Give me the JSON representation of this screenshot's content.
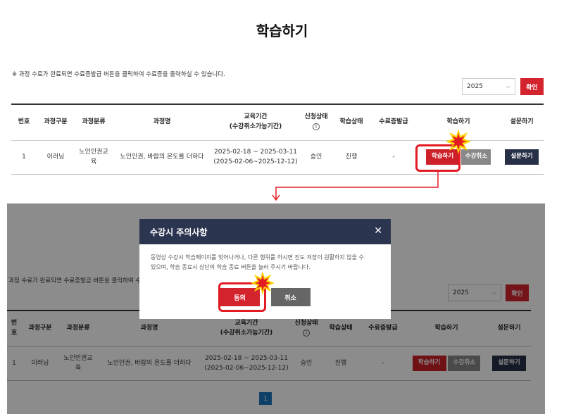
{
  "page_title": "학습하기",
  "notice": "※ 과정 수료가 완료되면 수료증발급 버튼을 클릭하여 수료증을 출력하실 수 있습니다.",
  "overlay_notice": "과정 수료가 완료되면 수료증발급 버튼을 클릭하여 수",
  "filter": {
    "year": "2025",
    "confirm_label": "확인"
  },
  "table": {
    "headers": {
      "no": "번호",
      "type": "과정구분",
      "category": "과정분류",
      "name": "과정명",
      "period_line1": "교육기간",
      "period_line2": "(수강취소가능기간)",
      "apply_status": "신청상태",
      "apply_info_icon": "i",
      "learn_status": "학습상태",
      "certificate": "수료증발급",
      "study": "학습하기",
      "survey": "설문하기"
    },
    "row": {
      "no": "1",
      "type": "이러닝",
      "category_main": "노인인권교",
      "category_sub": "육",
      "name": "노인인권, 바람의 온도를 더하다",
      "period_line1": "2025-02-18 ~ 2025-03-11",
      "period_line2": "(2025-02-06~2025-12-12)",
      "apply_status": "승인",
      "learn_status": "진행",
      "certificate": "-",
      "study_label": "학습하기",
      "cancel_label": "수강취소",
      "survey_label": "설문하기"
    }
  },
  "modal": {
    "title": "수강시 주의사항",
    "close_glyph": "✕",
    "body_line1": "동영상 수강시 학습페이지를 벗어나거나, 다른 행위를 하시면 진도 저장이 원활하지 않을 수",
    "body_line2": "있으며, 학습 종료시 상단의 학습 종료 버튼을 눌러 주시기 바랍니다.",
    "agree_label": "동의",
    "cancel_label": "취소"
  },
  "pagination": {
    "current": "1"
  },
  "colors": {
    "accent_red": "#d3232c",
    "modal_header": "#2b3550",
    "navy_button": "#273047",
    "pager_blue": "#1e73be"
  },
  "icons": {
    "chevron": "chevron-down-icon",
    "close": "close-icon",
    "info": "info-icon",
    "highlight": "starburst-icon",
    "arrow": "arrow-down-icon"
  }
}
